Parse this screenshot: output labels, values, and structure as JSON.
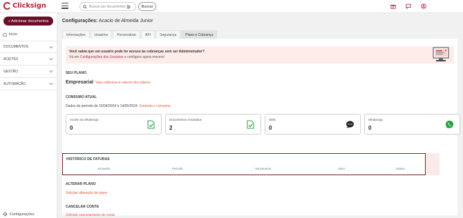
{
  "app": {
    "logo_text": "Clicksign",
    "brand_color": "#b22a3b"
  },
  "topbar": {
    "search_placeholder": "Buscar por documentos",
    "search_button": "Buscar",
    "icons": [
      "gift-icon",
      "chat-icon",
      "user-icon"
    ]
  },
  "sidebar": {
    "add_button": "+ Adicionar documentos",
    "home": "Início",
    "items": [
      {
        "label": "DOCUMENTOS"
      },
      {
        "label": "ACEITES"
      },
      {
        "label": "GESTÃO"
      },
      {
        "label": "AUTOMAÇÃO"
      }
    ],
    "settings": "Configurações"
  },
  "page": {
    "title_prefix": "Configurações:",
    "title_name": "Acacio de Almeida Junior",
    "tabs": [
      {
        "label": "Informações",
        "active": false
      },
      {
        "label": "Usuários",
        "active": false
      },
      {
        "label": "Personalizar",
        "active": false
      },
      {
        "label": "API",
        "active": false
      },
      {
        "label": "Segurança",
        "active": false
      },
      {
        "label": "Plano e Cobrança",
        "active": true
      }
    ]
  },
  "banner": {
    "title": "Você sabia que um usuário pode ter acesso às cobranças sem ser Administrador?",
    "text_before": "Vá em",
    "link": "Configurações dos Usuários",
    "text_after": "e configure agora mesmo!"
  },
  "plan": {
    "section_title": "SEU PLANO",
    "name": "Empresarial",
    "link": "Veja cobertura e valores dos planos."
  },
  "consumption": {
    "section_title": "CONSUMO ATUAL",
    "period_text": "Dados do período de 15/04/2024 à 14/05/2024.",
    "period_link": "Entenda o consumo.",
    "cards": [
      {
        "label": "Aceite via WhatsApp",
        "value": "0",
        "icon": "document-check-icon"
      },
      {
        "label": "Documentos Assinados",
        "value": "2",
        "icon": "document-check-icon"
      },
      {
        "label": "SMS",
        "value": "0",
        "icon": "sms-bubble-icon"
      },
      {
        "label": "WhatsApp",
        "value": "0",
        "icon": "whatsapp-icon"
      }
    ]
  },
  "invoices": {
    "section_title": "HISTÓRICO DE FATURAS",
    "columns": [
      "Emissão",
      "Período",
      "Vencimento",
      "Valor",
      "Status"
    ]
  },
  "change_plan": {
    "section_title": "ALTERAR PLANO",
    "link": "Solicitar alteração de plano"
  },
  "cancel": {
    "section_title": "CANCELAR CONTA",
    "link": "Solicitar cancelamento de conta"
  }
}
